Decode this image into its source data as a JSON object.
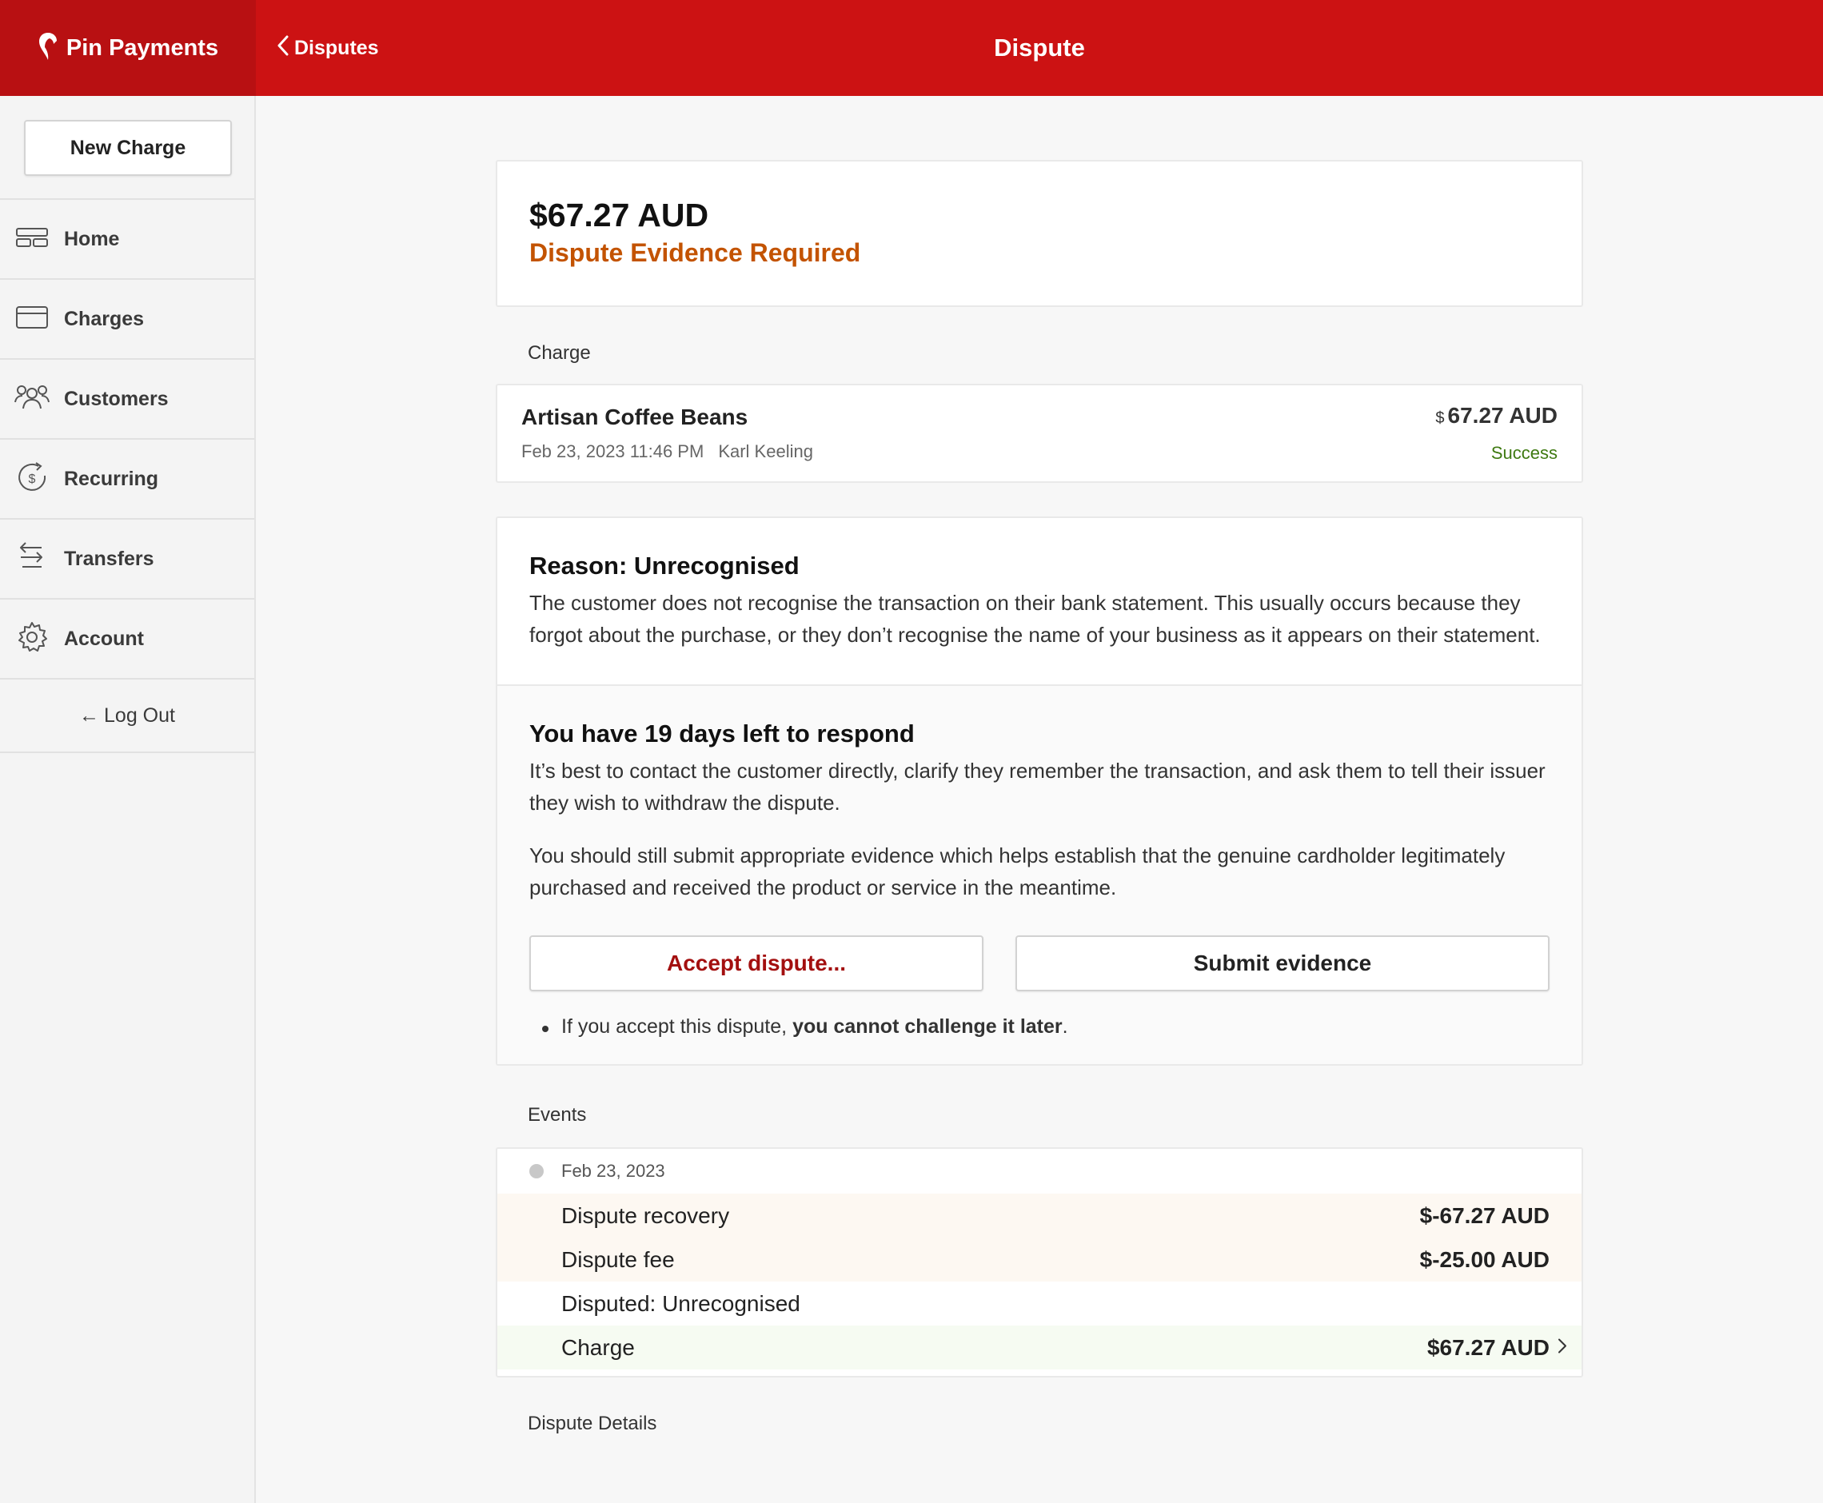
{
  "header": {
    "brand": "Pin Payments",
    "back_label": "Disputes",
    "title": "Dispute"
  },
  "sidebar": {
    "new_charge": "New Charge",
    "items": [
      {
        "label": "Home",
        "icon": "home-icon"
      },
      {
        "label": "Charges",
        "icon": "card-icon"
      },
      {
        "label": "Customers",
        "icon": "customers-icon"
      },
      {
        "label": "Recurring",
        "icon": "recurring-icon"
      },
      {
        "label": "Transfers",
        "icon": "transfers-icon"
      },
      {
        "label": "Account",
        "icon": "gear-icon"
      }
    ],
    "logout": "Log Out"
  },
  "dispute": {
    "amount": "$67.27 AUD",
    "status": "Dispute Evidence Required"
  },
  "charge_section": {
    "label": "Charge",
    "title": "Artisan Coffee Beans",
    "date": "Feb 23, 2023 11:46 PM",
    "customer": "Karl Keeling",
    "currency_symbol": "$",
    "amount": "67.27 AUD",
    "status": "Success"
  },
  "reason": {
    "title": "Reason: Unrecognised",
    "text": "The customer does not recognise the transaction on their bank statement. This usually occurs because they forgot about the purchase, or they don’t recognise the name of your business as it appears on their statement."
  },
  "respond": {
    "title": "You have 19 days left to respond",
    "text1": "It’s best to contact the customer directly, clarify they remember the transaction, and ask them to tell their issuer they wish to withdraw the dispute.",
    "text2": "You should still submit appropriate evidence which helps establish that the genuine cardholder legitimately purchased and received the product or service in the meantime.",
    "accept_label": "Accept dispute...",
    "submit_label": "Submit evidence",
    "note_prefix": "If you accept this dispute, ",
    "note_bold": "you cannot challenge it later",
    "note_suffix": "."
  },
  "events": {
    "label": "Events",
    "date": "Feb 23, 2023",
    "rows": [
      {
        "name": "Dispute recovery",
        "amount": "$-67.27 AUD"
      },
      {
        "name": "Dispute fee",
        "amount": "$-25.00 AUD"
      },
      {
        "name": "Disputed: Unrecognised",
        "amount": ""
      },
      {
        "name": "Charge",
        "amount": "$67.27 AUD"
      }
    ]
  },
  "details_label": "Dispute Details",
  "colors": {
    "brand_red": "#cc1213",
    "status_orange": "#c35300",
    "success_green": "#3f7a12",
    "accept_red": "#a30f0f"
  }
}
